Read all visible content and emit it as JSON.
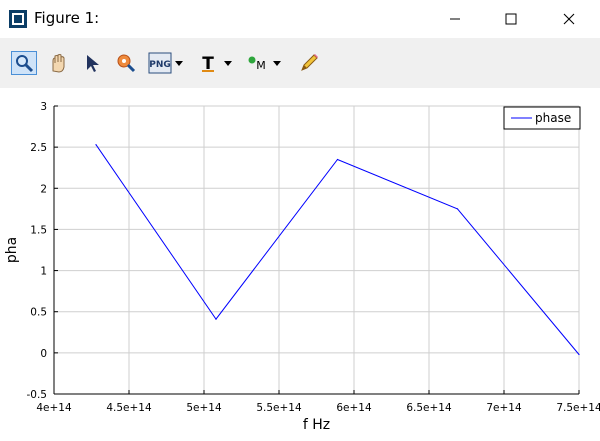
{
  "window": {
    "title": "Figure 1:",
    "controls": [
      "minimize",
      "maximize",
      "close"
    ]
  },
  "toolbar": {
    "tools": [
      {
        "icon": "zoom-icon",
        "active": true
      },
      {
        "icon": "pan-hand-icon",
        "active": false
      },
      {
        "icon": "select-arrow-icon",
        "active": false
      },
      {
        "icon": "rotate-icon",
        "active": false
      },
      {
        "icon": "png-export-icon",
        "label": "PNG",
        "dropdown": true
      },
      {
        "icon": "text-tool-icon",
        "label": "T",
        "dropdown": true
      },
      {
        "icon": "marker-tool-icon",
        "label": "M",
        "dropdown": true
      },
      {
        "icon": "pencil-icon",
        "active": false
      }
    ]
  },
  "chart_data": {
    "type": "line",
    "title": "",
    "xlabel": "f Hz",
    "ylabel": "pha",
    "xlim": [
      400000000000000.0,
      750000000000000.0
    ],
    "ylim": [
      -0.5,
      3
    ],
    "x_ticks": [
      400000000000000.0,
      450000000000000.0,
      500000000000000.0,
      550000000000000.0,
      600000000000000.0,
      650000000000000.0,
      700000000000000.0,
      750000000000000.0
    ],
    "x_tick_labels": [
      "4e+14",
      "4.5e+14",
      "5e+14",
      "5.5e+14",
      "6e+14",
      "6.5e+14",
      "7e+14",
      "7.5e+14"
    ],
    "y_ticks": [
      -0.5,
      0,
      0.5,
      1,
      1.5,
      2,
      2.5,
      3
    ],
    "y_tick_labels": [
      "-0.5",
      "0",
      "0.5",
      "1",
      "1.5",
      "2",
      "2.5",
      "3"
    ],
    "grid": true,
    "legend_position": "top-right",
    "series": [
      {
        "name": "phase",
        "color": "#0000ff",
        "x": [
          428000000000000.0,
          508000000000000.0,
          589000000000000.0,
          669000000000000.0,
          750000000000000.0
        ],
        "y": [
          2.53,
          0.41,
          2.35,
          1.75,
          -0.02
        ]
      }
    ]
  }
}
